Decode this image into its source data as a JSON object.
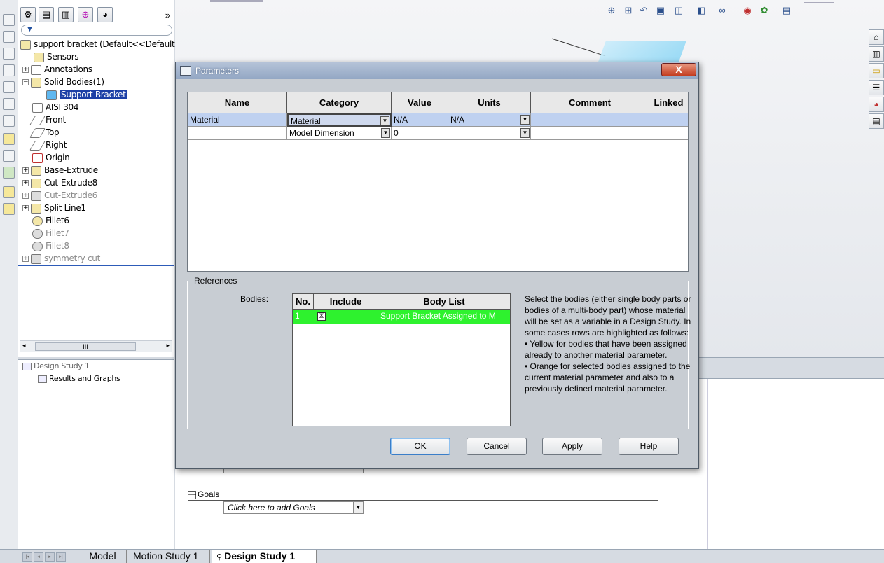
{
  "feature_manager": {
    "filter_icon": "filter-icon",
    "more": "»",
    "tree": [
      {
        "label": "support bracket  (Default<<Default>_Displ",
        "icon": "part-icon",
        "state": "normal"
      },
      {
        "label": "Sensors",
        "icon": "sensor-icon",
        "state": "normal"
      },
      {
        "label": "Annotations",
        "icon": "annotation-icon",
        "state": "normal"
      },
      {
        "label": "Solid Bodies(1)",
        "icon": "folder-icon",
        "state": "normal"
      },
      {
        "label": "Support Bracket",
        "icon": "solid-body-icon",
        "state": "selected"
      },
      {
        "label": "AISI 304",
        "icon": "material-icon",
        "state": "normal"
      },
      {
        "label": "Front",
        "icon": "plane-icon",
        "state": "normal"
      },
      {
        "label": "Top",
        "icon": "plane-icon",
        "state": "normal"
      },
      {
        "label": "Right",
        "icon": "plane-icon",
        "state": "normal"
      },
      {
        "label": "Origin",
        "icon": "origin-icon",
        "state": "normal"
      },
      {
        "label": "Base-Extrude",
        "icon": "extrude-icon",
        "state": "normal"
      },
      {
        "label": "Cut-Extrude8",
        "icon": "cut-extrude-icon",
        "state": "normal"
      },
      {
        "label": "Cut-Extrude6",
        "icon": "cut-extrude-icon",
        "state": "suppressed"
      },
      {
        "label": "Split Line1",
        "icon": "split-line-icon",
        "state": "normal"
      },
      {
        "label": "Fillet6",
        "icon": "fillet-icon",
        "state": "normal"
      },
      {
        "label": "Fillet7",
        "icon": "fillet-icon",
        "state": "suppressed"
      },
      {
        "label": "Fillet8",
        "icon": "fillet-icon",
        "state": "suppressed"
      },
      {
        "label": "symmetry cut",
        "icon": "cut-icon",
        "state": "suppressed"
      }
    ],
    "scroll_thumb": "III"
  },
  "design_study_tree": {
    "root": "Design Study 1",
    "child": "Results and Graphs"
  },
  "dialog": {
    "title": "Parameters",
    "close": "X",
    "columns": [
      "Name",
      "Category",
      "Value",
      "Units",
      "Comment",
      "Linked"
    ],
    "rows": [
      {
        "name": "Material",
        "category": "Material",
        "value": "N/A",
        "units": "N/A",
        "comment": "",
        "linked": ""
      },
      {
        "name": "",
        "category": "Model Dimension",
        "value": "0",
        "units": "",
        "comment": "",
        "linked": ""
      }
    ],
    "references": {
      "legend": "References",
      "bodies_label": "Bodies:",
      "columns": [
        "No.",
        "Include",
        "Body List"
      ],
      "rows": [
        {
          "no": "1",
          "include": "☒",
          "body": "Support Bracket Assigned to M"
        }
      ],
      "help": [
        "Select the bodies (either single body parts or bodies of a multi-body part) whose material will be set as a variable in a Design Study. In some cases rows are highlighted as follows:",
        "• Yellow for bodies that have been assigned already to another material parameter.",
        "• Orange for selected bodies assigned to the current material parameter and also to a previously defined material parameter."
      ]
    },
    "buttons": {
      "ok": "OK",
      "cancel": "Cancel",
      "apply": "Apply",
      "help": "Help"
    },
    "row_highlight_color": "#bfd1f0",
    "include_row_color": "#2ef22e"
  },
  "goals": {
    "title": "Goals",
    "collapse": "—",
    "dropdown": "Click here to add Goals"
  },
  "bottom_tabs": {
    "model": "Model",
    "motion": "Motion Study 1",
    "design": "Design Study 1"
  },
  "view_toolbar_icons": [
    "zoom-to-fit-icon",
    "zoom-area-icon",
    "previous-view-icon",
    "section-view-icon",
    "view-orientation-icon",
    "display-style-icon",
    "hide-show-icon",
    "edit-appearance-icon",
    "apply-scene-icon",
    "view-settings-icon"
  ],
  "task_pane_icons": [
    "home-icon",
    "library-icon",
    "folder-icon",
    "view-palette-icon",
    "appearances-icon",
    "custom-properties-icon"
  ]
}
